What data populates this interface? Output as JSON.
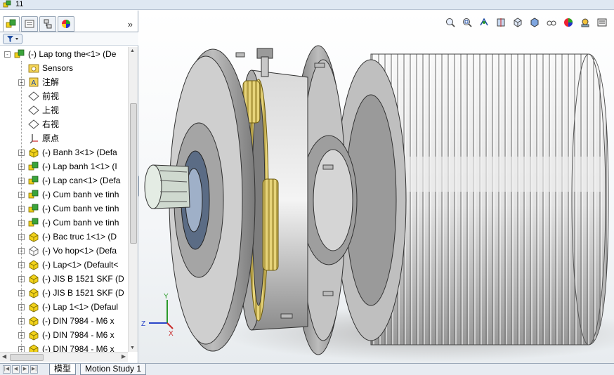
{
  "window": {
    "title": "11",
    "icon": "assembly-icon"
  },
  "panel": {
    "tabs": [
      {
        "name": "feature-manager-tab",
        "icon": "feature-tree-icon"
      },
      {
        "name": "property-manager-tab",
        "icon": "property-icon"
      },
      {
        "name": "configuration-manager-tab",
        "icon": "configuration-icon"
      },
      {
        "name": "display-manager-tab",
        "icon": "appearance-icon"
      }
    ],
    "more_label": "»",
    "filter_icon": "filter-icon"
  },
  "tree": {
    "items": [
      {
        "label": "(-) Lap tong the<1> (De",
        "icon": "assembly-icon",
        "expander": "-",
        "level": 0
      },
      {
        "label": "Sensors",
        "icon": "sensor-folder-icon",
        "expander": "",
        "level": 1
      },
      {
        "label": "注解",
        "icon": "annotation-icon",
        "expander": "+",
        "level": 1
      },
      {
        "label": "前视",
        "icon": "plane-icon",
        "expander": "",
        "level": 1
      },
      {
        "label": "上视",
        "icon": "plane-icon",
        "expander": "",
        "level": 1
      },
      {
        "label": "右视",
        "icon": "plane-icon",
        "expander": "",
        "level": 1
      },
      {
        "label": "原点",
        "icon": "origin-icon",
        "expander": "",
        "level": 1
      },
      {
        "label": "(-) Banh 3<1> (Defa",
        "icon": "part-icon",
        "expander": "+",
        "level": 1
      },
      {
        "label": "(-) Lap banh 1<1> (I",
        "icon": "assembly-icon",
        "expander": "+",
        "level": 1
      },
      {
        "label": "(-) Lap can<1> (Defa",
        "icon": "assembly-icon",
        "expander": "+",
        "level": 1
      },
      {
        "label": "(-) Cum banh ve tinh",
        "icon": "assembly-icon",
        "expander": "+",
        "level": 1
      },
      {
        "label": "(-) Cum banh ve tinh",
        "icon": "assembly-icon",
        "expander": "+",
        "level": 1
      },
      {
        "label": "(-) Cum banh ve tinh",
        "icon": "assembly-icon",
        "expander": "+",
        "level": 1
      },
      {
        "label": "(-) Bac truc 1<1> (D",
        "icon": "part-icon",
        "expander": "+",
        "level": 1
      },
      {
        "label": "(-) Vo hop<1> (Defa",
        "icon": "part-hidden-icon",
        "expander": "+",
        "level": 1
      },
      {
        "label": "(-) Lap<1> (Default<",
        "icon": "part-icon",
        "expander": "+",
        "level": 1
      },
      {
        "label": "(-) JIS B 1521 SKF (D",
        "icon": "part-icon",
        "expander": "+",
        "level": 1
      },
      {
        "label": "(-) JIS B 1521 SKF (D",
        "icon": "part-icon",
        "expander": "+",
        "level": 1
      },
      {
        "label": "(-) Lap 1<1> (Defaul",
        "icon": "part-icon",
        "expander": "+",
        "level": 1
      },
      {
        "label": "(-) DIN 7984 - M6 x",
        "icon": "part-icon",
        "expander": "+",
        "level": 1
      },
      {
        "label": "(-) DIN 7984 - M6 x",
        "icon": "part-icon",
        "expander": "+",
        "level": 1
      },
      {
        "label": "(-) DIN 7984 - M6 x",
        "icon": "part-icon",
        "expander": "+",
        "level": 1
      }
    ]
  },
  "heads_up": [
    "zoom-to-fit-icon",
    "zoom-to-area-icon",
    "previous-view-icon",
    "section-view-icon",
    "view-orientation-icon",
    "display-style-icon",
    "hide-show-items-icon",
    "edit-appearance-icon",
    "apply-scene-icon",
    "view-settings-icon"
  ],
  "triad": {
    "x_label": "X",
    "y_label": "Y",
    "z_label": "Z"
  },
  "bottom_tabs": [
    {
      "label": "模型",
      "active": true
    },
    {
      "label": "Motion Study 1",
      "active": false
    }
  ],
  "colors": {
    "part_yellow": "#f2d21a",
    "part_green": "#3aa33a",
    "selection_blue": "#1b4aa0"
  }
}
